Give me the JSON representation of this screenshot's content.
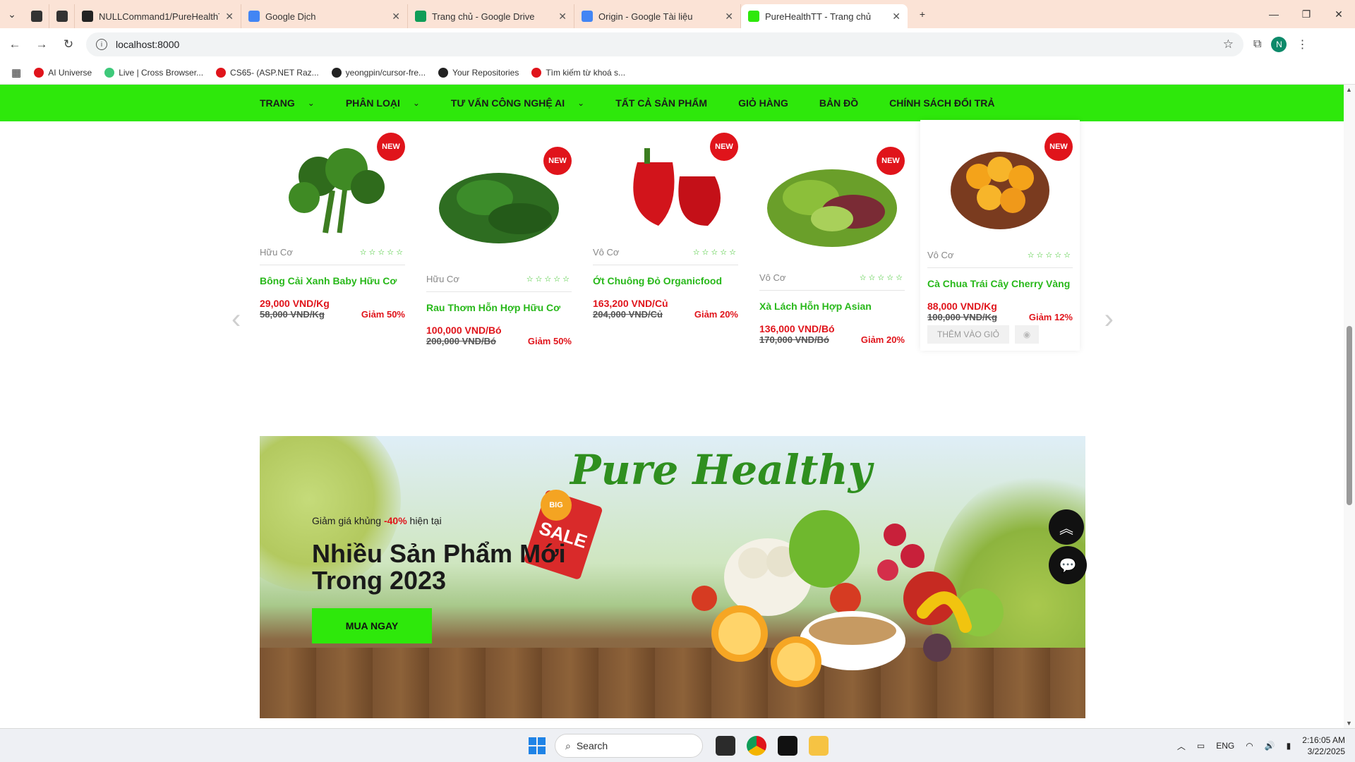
{
  "browser": {
    "tabs": [
      {
        "title": "",
        "favicon_color": "#333333"
      },
      {
        "title": "",
        "favicon_color": "#333333"
      },
      {
        "title": "NULLCommand1/PureHealthTT",
        "favicon_color": "#222222"
      },
      {
        "title": "Google Dịch",
        "favicon_color": "#4285f4"
      },
      {
        "title": "Trang chủ - Google Drive",
        "favicon_color": "#0f9d58"
      },
      {
        "title": "Origin - Google Tài liệu",
        "favicon_color": "#4285f4"
      },
      {
        "title": "PureHealthTT - Trang chủ",
        "favicon_color": "#2ee80b",
        "active": true
      }
    ],
    "url": "localhost:8000",
    "profile_initial": "N",
    "bookmarks": [
      {
        "label": "AI Universe",
        "color": "#e0141b"
      },
      {
        "label": "Live | Cross Browser...",
        "color": "#3ec97a"
      },
      {
        "label": "CS65- (ASP.NET Raz...",
        "color": "#e0141b"
      },
      {
        "label": "yeongpin/cursor-fre...",
        "color": "#222222"
      },
      {
        "label": "Your Repositories",
        "color": "#222222"
      },
      {
        "label": "Tìm kiếm từ khoá s...",
        "color": "#e0141b"
      }
    ]
  },
  "nav": {
    "items": [
      {
        "label": "TRANG",
        "has_dropdown": true
      },
      {
        "label": "PHÂN LOẠI",
        "has_dropdown": true
      },
      {
        "label": "TƯ VẤN CÔNG NGHỆ AI",
        "has_dropdown": true
      },
      {
        "label": "TẤT CẢ SẢN PHẨM",
        "has_dropdown": false
      },
      {
        "label": "GIỎ HÀNG",
        "has_dropdown": false
      },
      {
        "label": "BẢN ĐỒ",
        "has_dropdown": false
      },
      {
        "label": "CHÍNH SÁCH ĐỔI TRẢ",
        "has_dropdown": false
      }
    ],
    "accent_color": "#2ee80b"
  },
  "products": [
    {
      "badge": "NEW",
      "category": "Hữu Cơ",
      "name": "Bông Cải Xanh Baby Hữu Cơ",
      "price": "29,000 VND/Kg",
      "old_price": "58,000 VND/Kg",
      "discount": "Giảm 50%",
      "rating": 0
    },
    {
      "badge": "NEW",
      "category": "Hữu Cơ",
      "name": "Rau Thơm Hỗn Hợp Hữu Cơ",
      "price": "100,000 VND/Bó",
      "old_price": "200,000 VND/Bó",
      "discount": "Giảm 50%",
      "rating": 0
    },
    {
      "badge": "NEW",
      "category": "Vô Cơ",
      "name": "Ớt Chuông Đỏ Organicfood",
      "price": "163,200 VND/Củ",
      "old_price": "204,000 VND/Củ",
      "discount": "Giảm 20%",
      "rating": 0
    },
    {
      "badge": "NEW",
      "category": "Vô Cơ",
      "name": "Xà Lách Hỗn Hợp Asian",
      "price": "136,000 VND/Bó",
      "old_price": "170,000 VND/Bó",
      "discount": "Giảm 20%",
      "rating": 0
    },
    {
      "badge": "NEW",
      "category": "Vô Cơ",
      "name": "Cà Chua Trái Cây Cherry Vàng",
      "price": "88,000 VND/Kg",
      "old_price": "100,000 VND/Kg",
      "discount": "Giảm 12%",
      "rating": 0,
      "add_to_cart": "THÊM VÀO GIỎ"
    }
  ],
  "banner": {
    "script_title": "Pure Healthy",
    "sale_badge": "BIG",
    "sale_tag": "SALE",
    "subline_pre": "Giảm giá khủng ",
    "subline_highlight": "-40%",
    "subline_post": " hiện tại",
    "headline": "Nhiều Sản Phẩm Mới Trong 2023",
    "button": "MUA NGAY"
  },
  "taskbar": {
    "search_placeholder": "Search",
    "language": "ENG",
    "time": "2:16:05 AM",
    "date": "3/22/2025"
  }
}
